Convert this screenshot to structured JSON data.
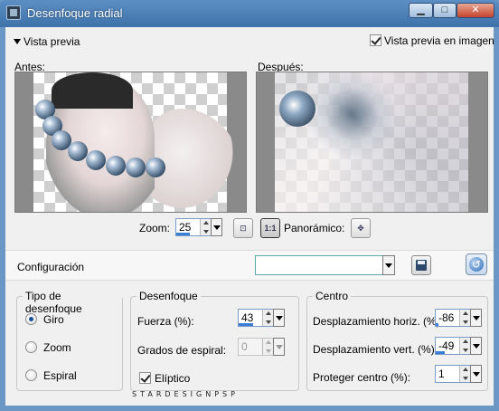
{
  "window": {
    "title": "Desenfoque radial"
  },
  "preview": {
    "toggle_label": "Vista previa",
    "show_in_image_label": "Vista previa en imagen",
    "show_in_image_checked": true,
    "before_label": "Antes:",
    "after_label": "Después:"
  },
  "zoom": {
    "label": "Zoom:",
    "value": "25",
    "panoramic_label": "Panorámico:",
    "one_to_one_label": "1:1"
  },
  "configuration": {
    "label": "Configuración",
    "value": ""
  },
  "blur_type": {
    "title": "Tipo de desenfoque",
    "options": [
      "Giro",
      "Zoom",
      "Espiral"
    ],
    "selected": "Giro"
  },
  "blur": {
    "title": "Desenfoque",
    "strength_label": "Fuerza (%):",
    "strength_value": "43",
    "spiral_label": "Grados de espiral:",
    "spiral_value": "0",
    "elliptical_label": "Elíptico",
    "elliptical_checked": true
  },
  "center": {
    "title": "Centro",
    "horiz_label": "Desplazamiento horiz. (%):",
    "horiz_value": "-86",
    "vert_label": "Desplazamiento vert. (%):",
    "vert_value": "-49",
    "protect_label": "Proteger centro (%):",
    "protect_value": "1"
  },
  "watermark": "STARDESIGNPSP",
  "colors": {
    "title_bar": "#4a7fb5",
    "accent": "#3a7fd6",
    "close": "#c4432b"
  }
}
